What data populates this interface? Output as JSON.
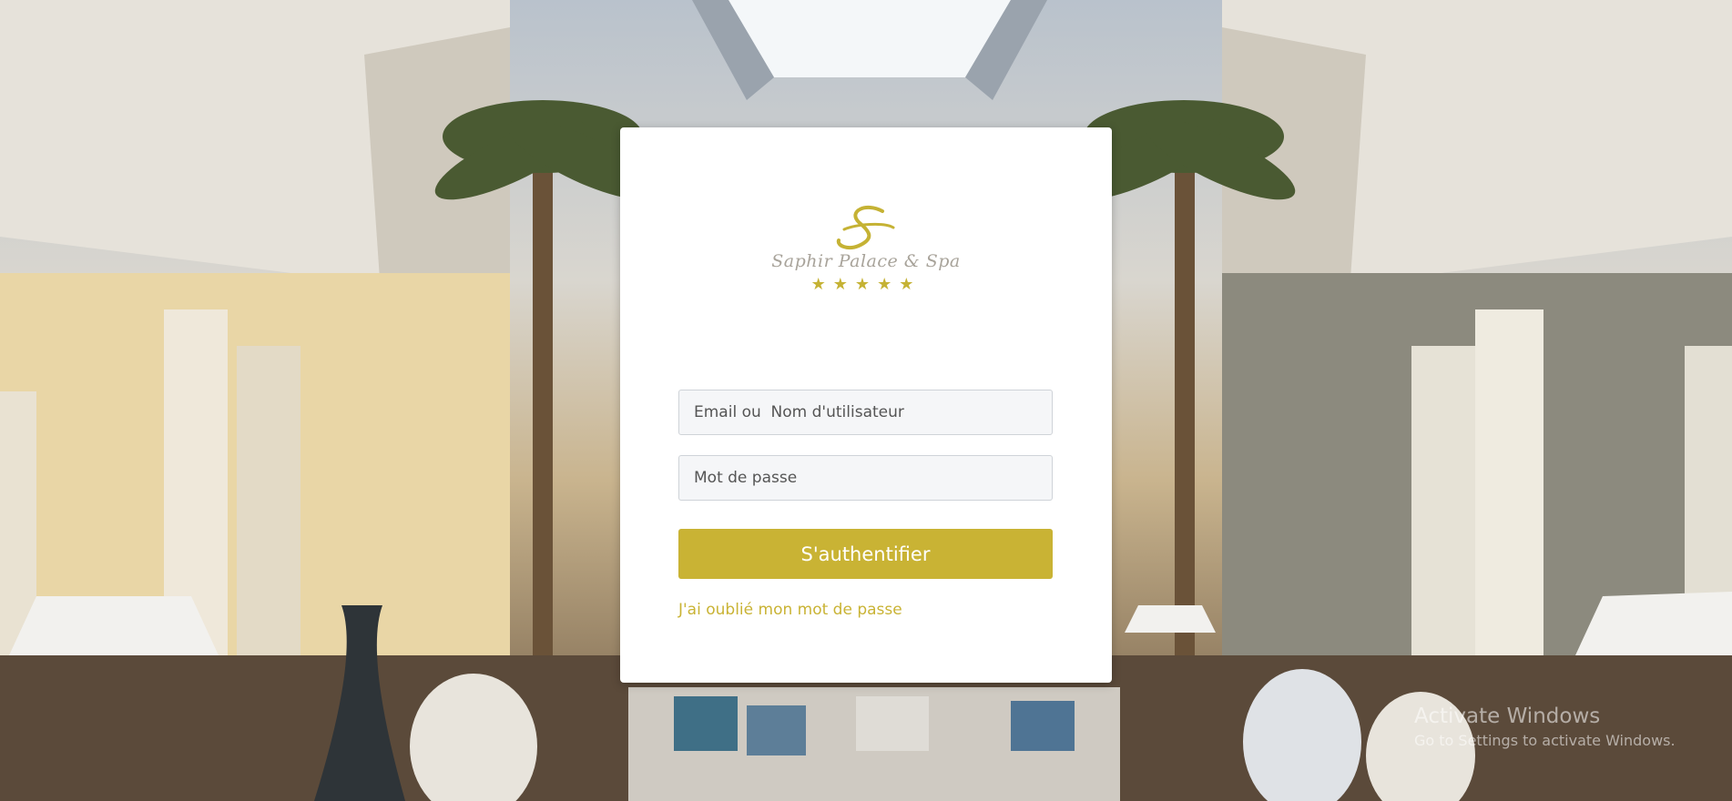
{
  "logo": {
    "monogram": "S",
    "name": "Saphir Palace & Spa",
    "stars": "★★★★★"
  },
  "form": {
    "email_placeholder": "Email ou  Nom d'utilisateur",
    "email_value": "",
    "password_placeholder": "Mot de passe",
    "password_value": "",
    "submit_label": "S'authentifier",
    "forgot_label": "J'ai oublié mon mot de passe"
  },
  "watermark": {
    "title": "Activate Windows",
    "subtitle": "Go to Settings to activate Windows."
  },
  "colors": {
    "accent": "#c9b334",
    "card": "#ffffff",
    "field_bg": "#f5f6f8"
  }
}
